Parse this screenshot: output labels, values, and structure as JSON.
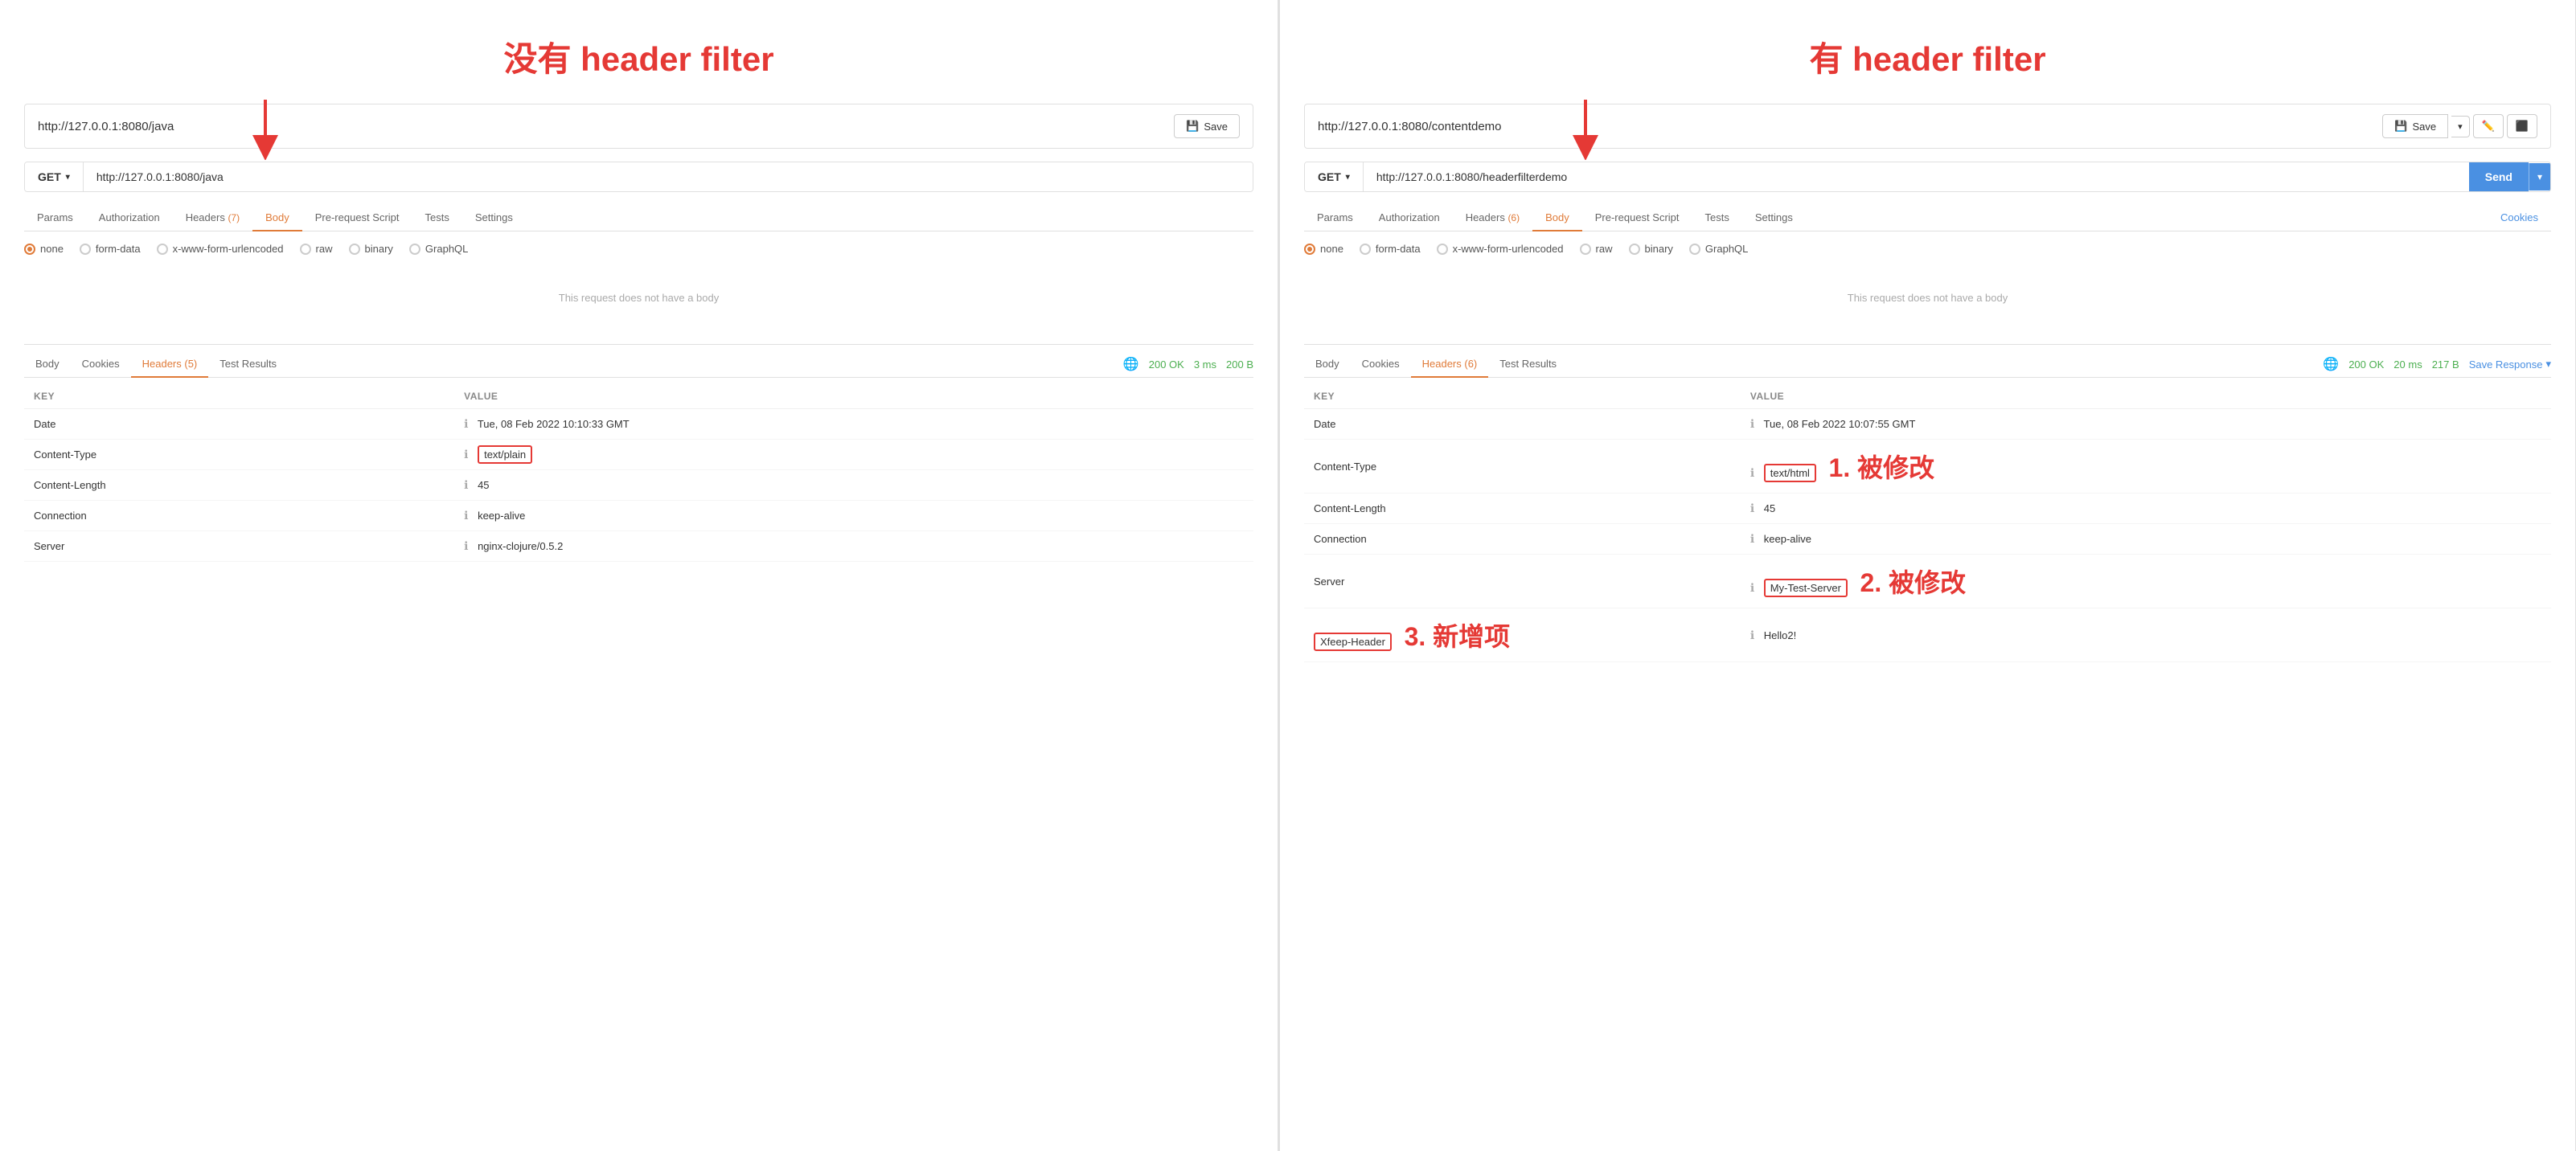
{
  "left": {
    "annotation": "没有 header filter",
    "url_display": "http://127.0.0.1:8080/java",
    "save_label": "Save",
    "method": "GET",
    "request_url": "http://127.0.0.1:8080/java",
    "tabs": [
      {
        "label": "Params",
        "active": false
      },
      {
        "label": "Authorization",
        "active": false
      },
      {
        "label": "Headers",
        "active": false,
        "count": "7"
      },
      {
        "label": "Body",
        "active": true
      },
      {
        "label": "Pre-request Script",
        "active": false
      },
      {
        "label": "Tests",
        "active": false
      },
      {
        "label": "Settings",
        "active": false
      }
    ],
    "body_types": [
      "none",
      "form-data",
      "x-www-form-urlencoded",
      "raw",
      "binary",
      "GraphQL"
    ],
    "no_body_text": "This request does not have a body",
    "response_tabs": [
      "Body",
      "Cookies",
      "Headers (5)",
      "Test Results"
    ],
    "response_active_tab": "Headers (5)",
    "status": "200 OK",
    "time": "3 ms",
    "size": "200 B",
    "headers": [
      {
        "key": "Date",
        "value": "Tue, 08 Feb 2022 10:10:33 GMT",
        "highlight_key": false,
        "highlight_value": false
      },
      {
        "key": "Content-Type",
        "value": "text/plain",
        "highlight_key": false,
        "highlight_value": true
      },
      {
        "key": "Content-Length",
        "value": "45",
        "highlight_key": false,
        "highlight_value": false
      },
      {
        "key": "Connection",
        "value": "keep-alive",
        "highlight_key": false,
        "highlight_value": false
      },
      {
        "key": "Server",
        "value": "nginx-clojure/0.5.2",
        "highlight_key": false,
        "highlight_value": false
      }
    ]
  },
  "right": {
    "annotation": "有 header filter",
    "url_display": "http://127.0.0.1:8080/contentdemo",
    "save_label": "Save",
    "send_label": "Send",
    "method": "GET",
    "request_url": "http://127.0.0.1:8080/headerfilterdemo",
    "tabs": [
      {
        "label": "Params",
        "active": false
      },
      {
        "label": "Authorization",
        "active": false
      },
      {
        "label": "Headers",
        "active": false,
        "count": "6"
      },
      {
        "label": "Body",
        "active": true
      },
      {
        "label": "Pre-request Script",
        "active": false
      },
      {
        "label": "Tests",
        "active": false
      },
      {
        "label": "Settings",
        "active": false
      },
      {
        "label": "Cookies",
        "active": false,
        "special": true
      }
    ],
    "body_types": [
      "none",
      "form-data",
      "x-www-form-urlencoded",
      "raw",
      "binary",
      "GraphQL"
    ],
    "no_body_text": "This request does not have a body",
    "response_tabs": [
      "Body",
      "Cookies",
      "Headers (6)",
      "Test Results"
    ],
    "response_active_tab": "Headers (6)",
    "status": "200 OK",
    "time": "20 ms",
    "size": "217 B",
    "save_response_label": "Save Response",
    "headers": [
      {
        "key": "Date",
        "value": "Tue, 08 Feb 2022 10:07:55 GMT",
        "highlight_key": false,
        "highlight_value": false
      },
      {
        "key": "Content-Type",
        "value": "text/html",
        "highlight_key": false,
        "highlight_value": true,
        "annotation": "1. 被修改"
      },
      {
        "key": "Content-Length",
        "value": "45",
        "highlight_key": false,
        "highlight_value": false
      },
      {
        "key": "Connection",
        "value": "keep-alive",
        "highlight_key": false,
        "highlight_value": false
      },
      {
        "key": "Server",
        "value": "My-Test-Server",
        "highlight_key": false,
        "highlight_value": true,
        "annotation": "2. 被修改"
      },
      {
        "key": "Xfeep-Header",
        "value": "Hello2!",
        "highlight_key": true,
        "highlight_value": false,
        "annotation": "3. 新增项"
      }
    ]
  }
}
